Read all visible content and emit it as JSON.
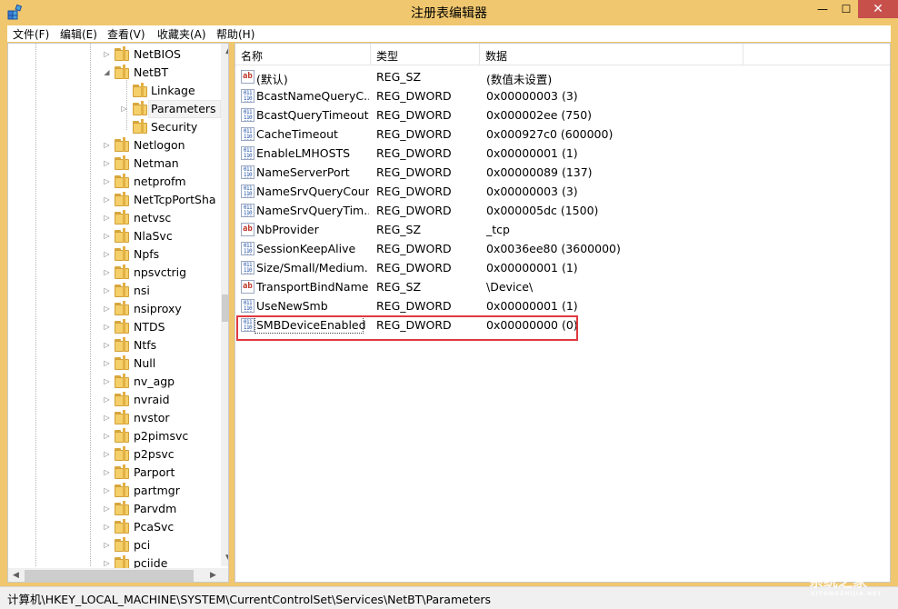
{
  "window": {
    "title": "注册表编辑器",
    "min_glyph": "—",
    "max_glyph": "☐",
    "close_glyph": "✕"
  },
  "menu": [
    "文件(F)",
    "编辑(E)",
    "查看(V)",
    "收藏夹(A)",
    "帮助(H)"
  ],
  "tree": {
    "items": [
      {
        "label": "NetBIOS",
        "expander": "▷"
      },
      {
        "label": "NetBT",
        "expander": "◢"
      },
      {
        "label": "Linkage",
        "expander": ""
      },
      {
        "label": "Parameters",
        "expander": "▷"
      },
      {
        "label": "Security",
        "expander": ""
      },
      {
        "label": "Netlogon",
        "expander": "▷"
      },
      {
        "label": "Netman",
        "expander": "▷"
      },
      {
        "label": "netprofm",
        "expander": "▷"
      },
      {
        "label": "NetTcpPortSha",
        "expander": "▷"
      },
      {
        "label": "netvsc",
        "expander": "▷"
      },
      {
        "label": "NlaSvc",
        "expander": "▷"
      },
      {
        "label": "Npfs",
        "expander": "▷"
      },
      {
        "label": "npsvctrig",
        "expander": "▷"
      },
      {
        "label": "nsi",
        "expander": "▷"
      },
      {
        "label": "nsiproxy",
        "expander": "▷"
      },
      {
        "label": "NTDS",
        "expander": "▷"
      },
      {
        "label": "Ntfs",
        "expander": "▷"
      },
      {
        "label": "Null",
        "expander": "▷"
      },
      {
        "label": "nv_agp",
        "expander": "▷"
      },
      {
        "label": "nvraid",
        "expander": "▷"
      },
      {
        "label": "nvstor",
        "expander": "▷"
      },
      {
        "label": "p2pimsvc",
        "expander": "▷"
      },
      {
        "label": "p2psvc",
        "expander": "▷"
      },
      {
        "label": "Parport",
        "expander": "▷"
      },
      {
        "label": "partmgr",
        "expander": "▷"
      },
      {
        "label": "Parvdm",
        "expander": "▷"
      },
      {
        "label": "PcaSvc",
        "expander": "▷"
      },
      {
        "label": "pci",
        "expander": "▷"
      },
      {
        "label": "pciide",
        "expander": "▷"
      }
    ]
  },
  "list": {
    "columns": [
      "名称",
      "类型",
      "数据"
    ],
    "rows": [
      {
        "name": "(默认)",
        "type": "REG_SZ",
        "data": "(数值未设置)",
        "icon": "string-value-icon"
      },
      {
        "name": "BcastNameQueryC...",
        "type": "REG_DWORD",
        "data": "0x00000003 (3)",
        "icon": "dword-value-icon"
      },
      {
        "name": "BcastQueryTimeout",
        "type": "REG_DWORD",
        "data": "0x000002ee (750)",
        "icon": "dword-value-icon"
      },
      {
        "name": "CacheTimeout",
        "type": "REG_DWORD",
        "data": "0x000927c0 (600000)",
        "icon": "dword-value-icon"
      },
      {
        "name": "EnableLMHOSTS",
        "type": "REG_DWORD",
        "data": "0x00000001 (1)",
        "icon": "dword-value-icon"
      },
      {
        "name": "NameServerPort",
        "type": "REG_DWORD",
        "data": "0x00000089 (137)",
        "icon": "dword-value-icon"
      },
      {
        "name": "NameSrvQueryCount",
        "type": "REG_DWORD",
        "data": "0x00000003 (3)",
        "icon": "dword-value-icon"
      },
      {
        "name": "NameSrvQueryTim...",
        "type": "REG_DWORD",
        "data": "0x000005dc (1500)",
        "icon": "dword-value-icon"
      },
      {
        "name": "NbProvider",
        "type": "REG_SZ",
        "data": "_tcp",
        "icon": "string-value-icon"
      },
      {
        "name": "SessionKeepAlive",
        "type": "REG_DWORD",
        "data": "0x0036ee80 (3600000)",
        "icon": "dword-value-icon"
      },
      {
        "name": "Size/Small/Medium...",
        "type": "REG_DWORD",
        "data": "0x00000001 (1)",
        "icon": "dword-value-icon"
      },
      {
        "name": "TransportBindName",
        "type": "REG_SZ",
        "data": "\\Device\\",
        "icon": "string-value-icon"
      },
      {
        "name": "UseNewSmb",
        "type": "REG_DWORD",
        "data": "0x00000001 (1)",
        "icon": "dword-value-icon"
      },
      {
        "name": "SMBDeviceEnabled",
        "type": "REG_DWORD",
        "data": "0x00000000 (0)",
        "icon": "dword-value-icon"
      }
    ]
  },
  "icons": {
    "sz_glyph": "ab",
    "dw_glyph": "011\n110\n010"
  },
  "status": {
    "path": "计算机\\HKEY_LOCAL_MACHINE\\SYSTEM\\CurrentControlSet\\Services\\NetBT\\Parameters"
  },
  "watermark": {
    "text": "系统之家",
    "sub": "XITONGZHIJIA.NET"
  },
  "colors": {
    "titlebar": "#f0c76e",
    "close": "#c7504b",
    "highlight": "#e0393e"
  }
}
